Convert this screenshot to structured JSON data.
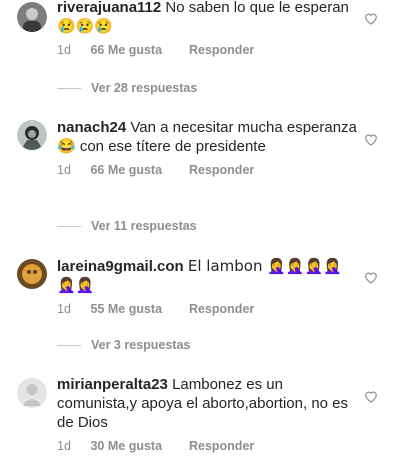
{
  "comments": [
    {
      "username": "riverajuana112",
      "text": "No saben lo que le esperan 😢😢😢",
      "time": "1d",
      "likes": "66 Me gusta",
      "reply": "Responder",
      "replies": "Ver 28 respuestas",
      "icons": {
        "avatar": "user-photo-avatar",
        "like": "heart-outline-icon"
      }
    },
    {
      "username": "nanach24",
      "text": "Van a necesitar mucha esperanza 😂 con ese títere de presidente",
      "time": "1d",
      "likes": "66 Me gusta",
      "reply": "Responder",
      "replies": "Ver 11 respuestas",
      "icons": {
        "avatar": "user-photo-avatar",
        "like": "heart-outline-icon"
      }
    },
    {
      "username": "lareina9gmail.con",
      "text": "El lambon 🤦‍♀️🤦‍♀️🤦‍♀️🤦‍♀️🤦‍♀️🤦‍♀️",
      "time": "1d",
      "likes": "55 Me gusta",
      "reply": "Responder",
      "replies": "Ver 3 respuestas",
      "icons": {
        "avatar": "user-photo-avatar",
        "like": "heart-outline-icon"
      }
    },
    {
      "username": "mirianperalta23",
      "text": "Lambonez es un comunista,y apoya el aborto,abortion, no es de Dios",
      "time": "1d",
      "likes": "30 Me gusta",
      "reply": "Responder",
      "icons": {
        "avatar": "default-user-avatar",
        "like": "heart-outline-icon"
      }
    }
  ]
}
